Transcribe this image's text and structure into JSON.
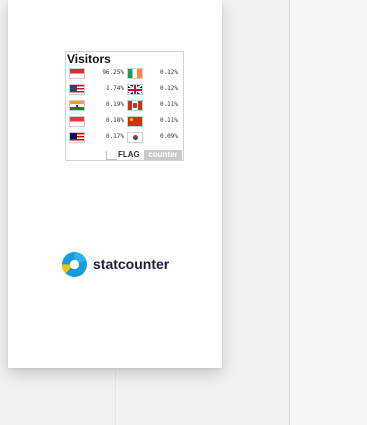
{
  "flag_counter": {
    "title": "Visitors",
    "rows": [
      {
        "left": {
          "flag": "indonesia-flag",
          "percent": "96.25%"
        },
        "right": {
          "flag": "ireland-flag",
          "percent": "0.12%"
        }
      },
      {
        "left": {
          "flag": "united-states-flag",
          "percent": "1.74%"
        },
        "right": {
          "flag": "united-kingdom-flag",
          "percent": "0.12%"
        }
      },
      {
        "left": {
          "flag": "india-flag",
          "percent": "0.19%"
        },
        "right": {
          "flag": "canada-flag",
          "percent": "0.11%"
        }
      },
      {
        "left": {
          "flag": "singapore-flag",
          "percent": "0.18%"
        },
        "right": {
          "flag": "china-flag",
          "percent": "0.11%"
        }
      },
      {
        "left": {
          "flag": "malaysia-flag",
          "percent": "0.17%"
        },
        "right": {
          "flag": "south-korea-flag",
          "percent": "0.09%"
        }
      }
    ],
    "footer": {
      "flag_word": "FLAG",
      "counter_word": "counter"
    }
  },
  "statcounter": {
    "label": "statcounter",
    "icon": "statcounter-logo-icon",
    "colors": {
      "blue": "#1a9ad9",
      "yellow": "#f2c500",
      "text": "#1d1d3a"
    }
  }
}
